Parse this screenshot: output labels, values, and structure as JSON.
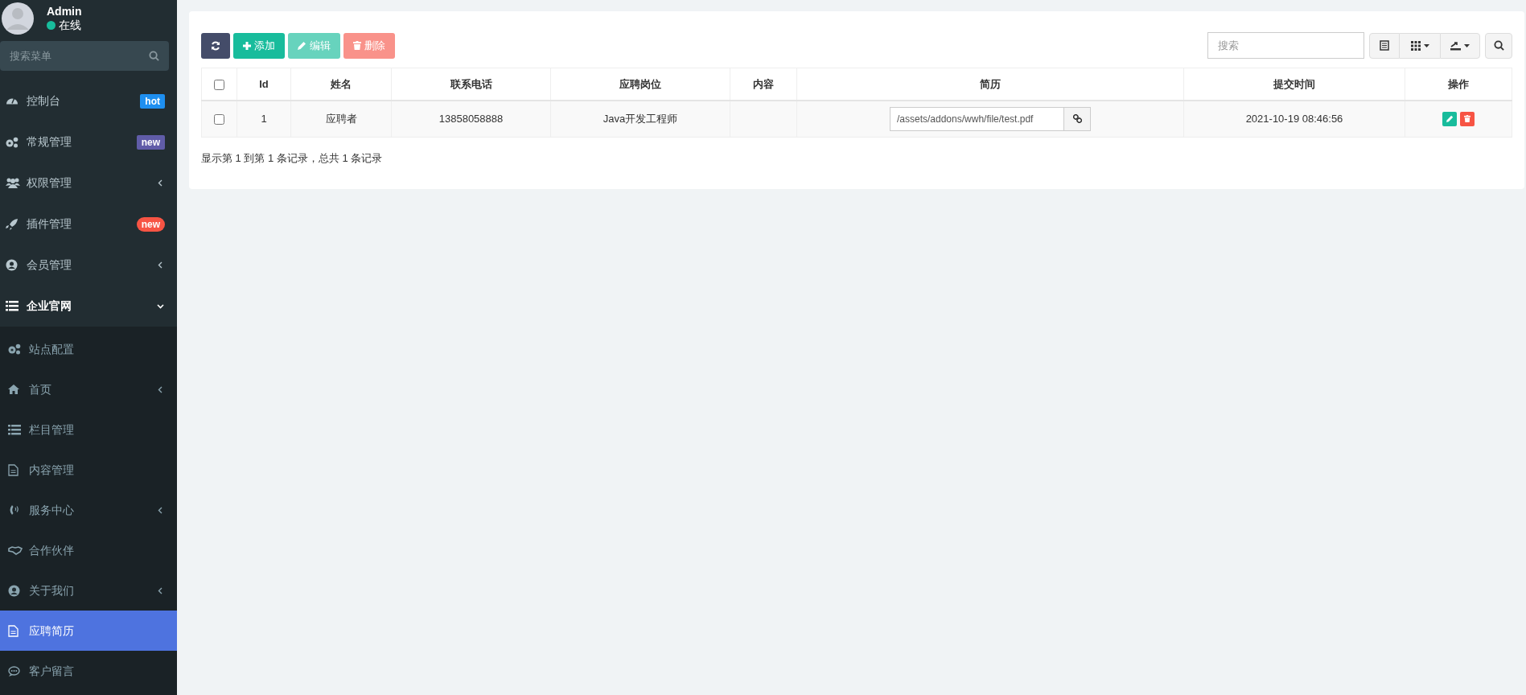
{
  "user": {
    "name": "Admin",
    "status": "在线"
  },
  "menu_search": {
    "placeholder": "搜索菜单"
  },
  "menu": [
    {
      "label": "控制台",
      "badge": {
        "text": "hot",
        "color": "#1e8ff0",
        "kind": "label"
      },
      "selected": false
    },
    {
      "label": "常规管理",
      "badge": {
        "text": "new",
        "color": "#605ca8",
        "kind": "label"
      },
      "selected": false
    },
    {
      "label": "权限管理",
      "expanded": false,
      "selected": false
    },
    {
      "label": "插件管理",
      "badge": {
        "text": "new",
        "color": "#f75444",
        "kind": "pill"
      },
      "selected": false
    },
    {
      "label": "会员管理",
      "expanded": false,
      "selected": false
    },
    {
      "label": "企业官网",
      "expanded": true,
      "selected": false,
      "children": [
        {
          "label": "站点配置",
          "selected": false
        },
        {
          "label": "首页",
          "expanded": false,
          "selected": false
        },
        {
          "label": "栏目管理",
          "selected": false
        },
        {
          "label": "内容管理",
          "selected": false
        },
        {
          "label": "服务中心",
          "expanded": false,
          "selected": false
        },
        {
          "label": "合作伙伴",
          "selected": false
        },
        {
          "label": "关于我们",
          "expanded": false,
          "selected": false
        },
        {
          "label": "应聘简历",
          "selected": true
        },
        {
          "label": "客户留言",
          "selected": false
        }
      ]
    }
  ],
  "toolbar": [
    {
      "kind": "refresh",
      "disabled": false
    },
    {
      "kind": "add",
      "label": "添加",
      "disabled": false
    },
    {
      "kind": "edit",
      "label": "编辑",
      "disabled": true
    },
    {
      "kind": "delete",
      "label": "删除",
      "disabled": true
    }
  ],
  "search": {
    "placeholder": "搜索"
  },
  "table": {
    "columns": [
      "Id",
      "姓名",
      "联系电话",
      "应聘岗位",
      "内容",
      "简历",
      "提交时间",
      "操作"
    ],
    "header_checked": false,
    "rows": [
      {
        "checked": false,
        "id": "1",
        "name": "应聘者",
        "phone": "13858058888",
        "position": "Java开发工程师",
        "resume": "/assets/addons/wwh/file/test.pdf",
        "time": "2021-10-19 08:46:56"
      }
    ]
  },
  "pagination_info": "显示第 1 到第 1 条记录，总共 1 条记录"
}
